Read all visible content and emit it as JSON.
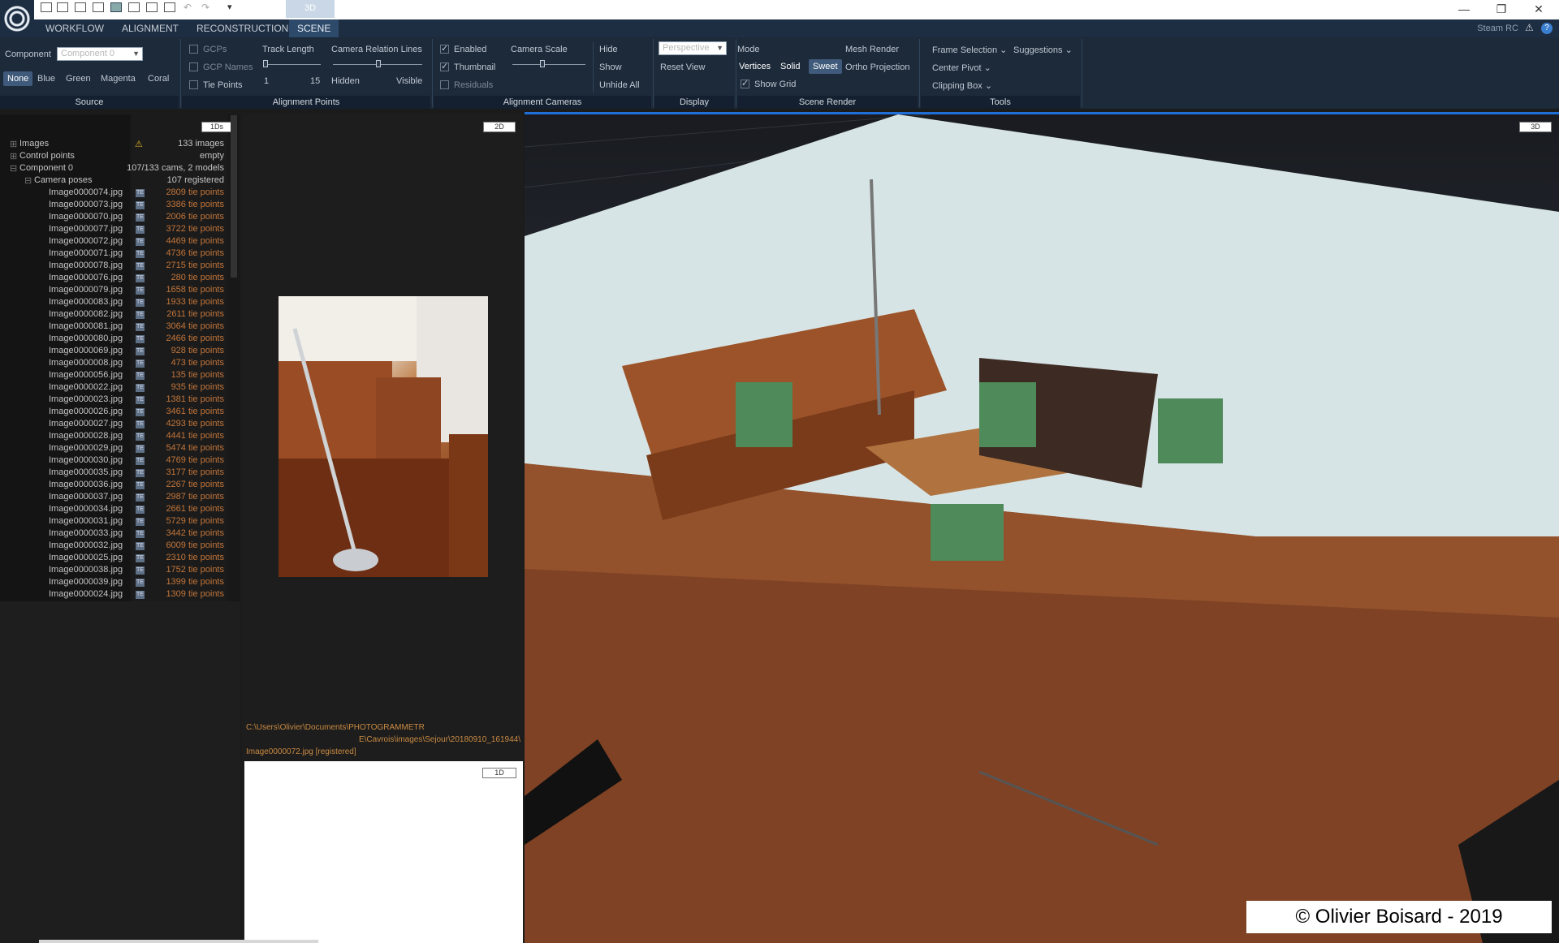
{
  "quick_access": {
    "scene_tab": "3D"
  },
  "window": {
    "minimize": "—",
    "maximize": "❐",
    "close": "✕"
  },
  "menu": {
    "items": [
      "WORKFLOW",
      "ALIGNMENT",
      "RECONSTRUCTION",
      "SCENE"
    ],
    "active": "SCENE",
    "right_label": "Steam RC"
  },
  "ribbon": {
    "source": {
      "component_label": "Component",
      "component_placeholder": "Component 0",
      "colors": [
        "None",
        "Blue",
        "Green",
        "Magenta",
        "Coral"
      ],
      "selected_color": "None",
      "group": "Source"
    },
    "alignment_points": {
      "checkboxes": [
        "GCPs",
        "GCP Names",
        "Tie Points"
      ],
      "track_length": "Track Length",
      "track_min": "1",
      "track_max": "15",
      "camera_relation_lines": "Camera Relation Lines",
      "hidden": "Hidden",
      "visible": "Visible",
      "group": "Alignment Points"
    },
    "alignment_cameras": {
      "enabled": "Enabled",
      "thumbnail": "Thumbnail",
      "residuals": "Residuals",
      "camera_scale": "Camera Scale",
      "hide": "Hide",
      "show": "Show",
      "unhide_all": "Unhide All",
      "group": "Alignment Cameras"
    },
    "display": {
      "projection": "Perspective",
      "reset_view": "Reset View",
      "group": "Display"
    },
    "scene_render": {
      "mode": "Mode",
      "modes": [
        "Vertices",
        "Solid",
        "Sweet"
      ],
      "selected_mode": "Sweet",
      "mesh_render": "Mesh Render",
      "ortho": "Ortho Projection",
      "show_grid": "Show Grid",
      "group": "Scene Render"
    },
    "tools": {
      "frame_selection": "Frame Selection",
      "suggestions": "Suggestions",
      "center_pivot": "Center Pivot",
      "clipping_box": "Clipping Box",
      "group": "Tools"
    }
  },
  "panel_1ds": {
    "tag": "1Ds",
    "tree": [
      {
        "label": "Images",
        "value": "133 images",
        "warn": true
      },
      {
        "label": "Control points",
        "value": "empty"
      },
      {
        "label": "Component 0",
        "value": "107/133 cams, 2 models"
      },
      {
        "label": "Camera poses",
        "value": "107 registered"
      }
    ],
    "images": [
      {
        "name": "Image0000074.jpg",
        "tp": "2809 tie points"
      },
      {
        "name": "Image0000073.jpg",
        "tp": "3386 tie points"
      },
      {
        "name": "Image0000070.jpg",
        "tp": "2006 tie points"
      },
      {
        "name": "Image0000077.jpg",
        "tp": "3722 tie points"
      },
      {
        "name": "Image0000072.jpg",
        "tp": "4469 tie points"
      },
      {
        "name": "Image0000071.jpg",
        "tp": "4736 tie points"
      },
      {
        "name": "Image0000078.jpg",
        "tp": "2715 tie points"
      },
      {
        "name": "Image0000076.jpg",
        "tp": "280 tie points"
      },
      {
        "name": "Image0000079.jpg",
        "tp": "1658 tie points"
      },
      {
        "name": "Image0000083.jpg",
        "tp": "1933 tie points"
      },
      {
        "name": "Image0000082.jpg",
        "tp": "2611 tie points"
      },
      {
        "name": "Image0000081.jpg",
        "tp": "3064 tie points"
      },
      {
        "name": "Image0000080.jpg",
        "tp": "2466 tie points"
      },
      {
        "name": "Image0000069.jpg",
        "tp": "928 tie points"
      },
      {
        "name": "Image0000008.jpg",
        "tp": "473 tie points"
      },
      {
        "name": "Image0000056.jpg",
        "tp": "135 tie points"
      },
      {
        "name": "Image0000022.jpg",
        "tp": "935 tie points"
      },
      {
        "name": "Image0000023.jpg",
        "tp": "1381 tie points"
      },
      {
        "name": "Image0000026.jpg",
        "tp": "3461 tie points"
      },
      {
        "name": "Image0000027.jpg",
        "tp": "4293 tie points"
      },
      {
        "name": "Image0000028.jpg",
        "tp": "4441 tie points"
      },
      {
        "name": "Image0000029.jpg",
        "tp": "5474 tie points"
      },
      {
        "name": "Image0000030.jpg",
        "tp": "4769 tie points"
      },
      {
        "name": "Image0000035.jpg",
        "tp": "3177 tie points"
      },
      {
        "name": "Image0000036.jpg",
        "tp": "2267 tie points"
      },
      {
        "name": "Image0000037.jpg",
        "tp": "2987 tie points"
      },
      {
        "name": "Image0000034.jpg",
        "tp": "2661 tie points"
      },
      {
        "name": "Image0000031.jpg",
        "tp": "5729 tie points"
      },
      {
        "name": "Image0000033.jpg",
        "tp": "3442 tie points"
      },
      {
        "name": "Image0000032.jpg",
        "tp": "6009 tie points"
      },
      {
        "name": "Image0000025.jpg",
        "tp": "2310 tie points"
      },
      {
        "name": "Image0000038.jpg",
        "tp": "1752 tie points"
      },
      {
        "name": "Image0000039.jpg",
        "tp": "1399 tie points"
      },
      {
        "name": "Image0000024.jpg",
        "tp": "1309 tie points"
      }
    ]
  },
  "panel_2d": {
    "tag": "2D",
    "path_line1": "C:\\Users\\Olivier\\Documents\\PHOTOGRAMMETR",
    "path_line2": "E\\Cavrois\\images\\Sejour\\20180910_161944\\",
    "path_line3": "Image0000072.jpg [registered]"
  },
  "panel_1d": {
    "tag": "1D"
  },
  "panel_3d": {
    "tag": "3D",
    "copyright": "© Olivier Boisard - 2019"
  },
  "colors": {
    "accent": "#1f6fd6",
    "ribbon": "#1c2a3a",
    "tie_points": "#c2753a"
  }
}
